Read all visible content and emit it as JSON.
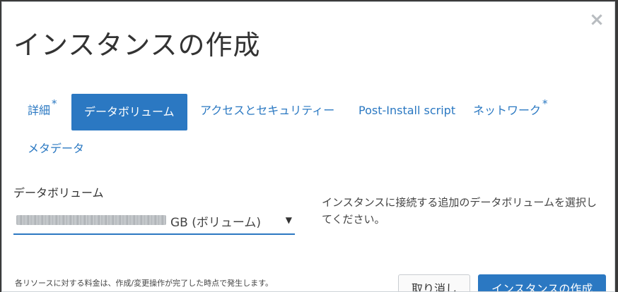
{
  "dialog": {
    "title": "インスタンスの作成",
    "close_icon": "close-icon"
  },
  "tabs": [
    {
      "label": "詳細",
      "required": "*",
      "active": false
    },
    {
      "label": "データボリューム",
      "required": "",
      "active": true
    },
    {
      "label": "アクセスとセキュリティー",
      "required": "",
      "active": false
    },
    {
      "label": "Post-Install script",
      "required": "",
      "active": false
    },
    {
      "label": "ネットワーク",
      "required": "*",
      "active": false
    },
    {
      "label": "メタデータ",
      "required": "",
      "active": false
    }
  ],
  "form": {
    "volume_label": "データボリューム",
    "volume_select_value": "GB (ボリューム)",
    "help_text": "インスタンスに接続する追加のデータボリュームを選択してください。"
  },
  "footer": {
    "note": "各リソースに対する料金は、作成/変更操作が完了した時点で発生します。",
    "cancel_label": "取り消し",
    "create_label": "インスタンスの作成"
  },
  "colors": {
    "accent": "#2b78c2"
  }
}
